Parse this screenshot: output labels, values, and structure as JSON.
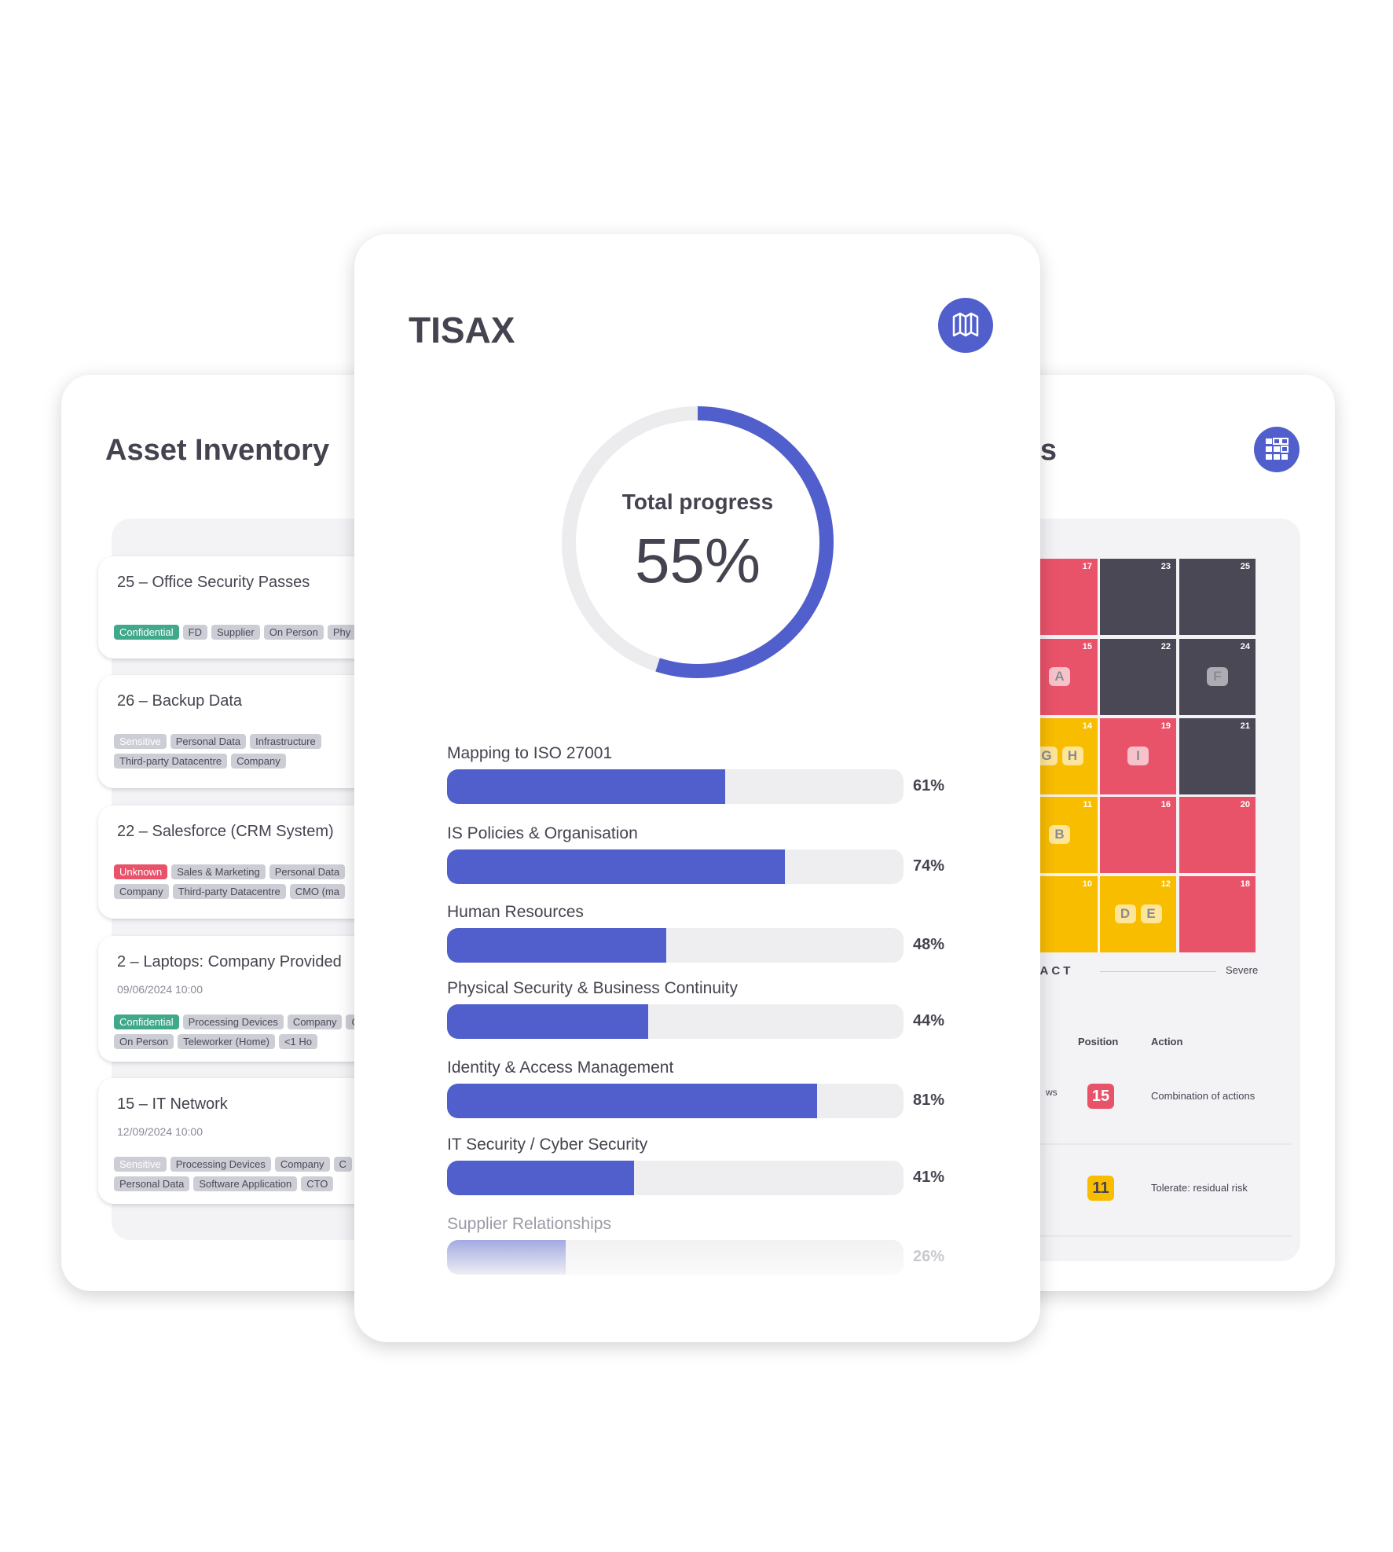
{
  "asset_inventory": {
    "title": "Asset Inventory",
    "items": [
      {
        "name": "25 – Office Security Passes",
        "date": "",
        "tags": [
          {
            "label": "Confidential",
            "kind": "green"
          },
          {
            "label": "FD"
          },
          {
            "label": "Supplier"
          },
          {
            "label": "On Person"
          },
          {
            "label": "Phy"
          }
        ]
      },
      {
        "name": "26 – Backup Data",
        "date": "",
        "tags": [
          {
            "label": "Sensitive",
            "kind": "blue"
          },
          {
            "label": "Personal Data"
          },
          {
            "label": "Infrastructure"
          },
          {
            "label": "Third-party Datacentre"
          },
          {
            "label": "Company"
          }
        ]
      },
      {
        "name": "22 – Salesforce (CRM System)",
        "date": "",
        "tags": [
          {
            "label": "Unknown",
            "kind": "red"
          },
          {
            "label": "Sales & Marketing"
          },
          {
            "label": "Personal Data"
          },
          {
            "label": "Company"
          },
          {
            "label": "Third-party Datacentre"
          },
          {
            "label": "CMO (ma"
          }
        ]
      },
      {
        "name": "2 – Laptops: Company Provided",
        "date": "09/06/2024  10:00",
        "tags": [
          {
            "label": "Confidential",
            "kind": "green"
          },
          {
            "label": "Processing Devices"
          },
          {
            "label": "Company"
          },
          {
            "label": "CTO"
          },
          {
            "label": "On Person"
          },
          {
            "label": "Teleworker (Home)"
          },
          {
            "label": "<1 Ho"
          }
        ]
      },
      {
        "name": "15 – IT Network",
        "date": "12/09/2024  10:00",
        "tags": [
          {
            "label": "Sensitive",
            "kind": "blue"
          },
          {
            "label": "Processing Devices"
          },
          {
            "label": "Company"
          },
          {
            "label": "C"
          },
          {
            "label": "Personal Data"
          },
          {
            "label": "Software Application"
          },
          {
            "label": "CTO"
          }
        ]
      }
    ]
  },
  "tisax": {
    "title": "TISAX",
    "icon": "map-icon",
    "total_label": "Total progress",
    "total_value": "55%",
    "total_progress": 55,
    "sections": [
      {
        "label": "Mapping to ISO 27001",
        "value": 61,
        "pct": "61%"
      },
      {
        "label": "IS Policies & Organisation",
        "value": 74,
        "pct": "74%"
      },
      {
        "label": "Human Resources",
        "value": 48,
        "pct": "48%"
      },
      {
        "label": "Physical Security & Business Continuity",
        "value": 44,
        "pct": "44%"
      },
      {
        "label": "Identity & Access Management",
        "value": 81,
        "pct": "81%"
      },
      {
        "label": "IT Security / Cyber Security",
        "value": 41,
        "pct": "41%"
      },
      {
        "label": "Supplier Relationships",
        "value": 26,
        "pct": "26%"
      }
    ]
  },
  "risk": {
    "title_fragment": "nts",
    "icon": "grid-icon",
    "matrix": [
      [
        {
          "n": "17",
          "c": "red"
        },
        {
          "n": "23",
          "c": "dark"
        },
        {
          "n": "25",
          "c": "dark"
        }
      ],
      [
        {
          "n": "15",
          "c": "red",
          "m": [
            "A"
          ]
        },
        {
          "n": "22",
          "c": "dark"
        },
        {
          "n": "24",
          "c": "dark",
          "m": [
            "F"
          ]
        }
      ],
      [
        {
          "n": "14",
          "c": "yellow",
          "m": [
            "G",
            "H"
          ]
        },
        {
          "n": "19",
          "c": "red",
          "m": [
            "I"
          ]
        },
        {
          "n": "21",
          "c": "dark"
        }
      ],
      [
        {
          "n": "11",
          "c": "yellow",
          "m": [
            "B"
          ]
        },
        {
          "n": "16",
          "c": "red"
        },
        {
          "n": "20",
          "c": "red"
        }
      ],
      [
        {
          "n": "10",
          "c": "yellow"
        },
        {
          "n": "12",
          "c": "yellow",
          "m": [
            "D",
            "E"
          ]
        },
        {
          "n": "18",
          "c": "red"
        }
      ]
    ],
    "impact_label": "IMPACT",
    "severe_label": "Severe",
    "table": {
      "headers": {
        "position": "Position",
        "action": "Action"
      },
      "rows": [
        {
          "fragment": "ws",
          "position": "15",
          "color": "red",
          "action": "Combination of actions"
        },
        {
          "fragment": "",
          "position": "11",
          "color": "yellow",
          "action": "Tolerate: residual risk"
        }
      ]
    }
  },
  "colors": {
    "accent": "#505fcb",
    "red": "#e9536a",
    "dark": "#4a4855",
    "yellow": "#f9bd00",
    "green": "#3fa98a"
  }
}
